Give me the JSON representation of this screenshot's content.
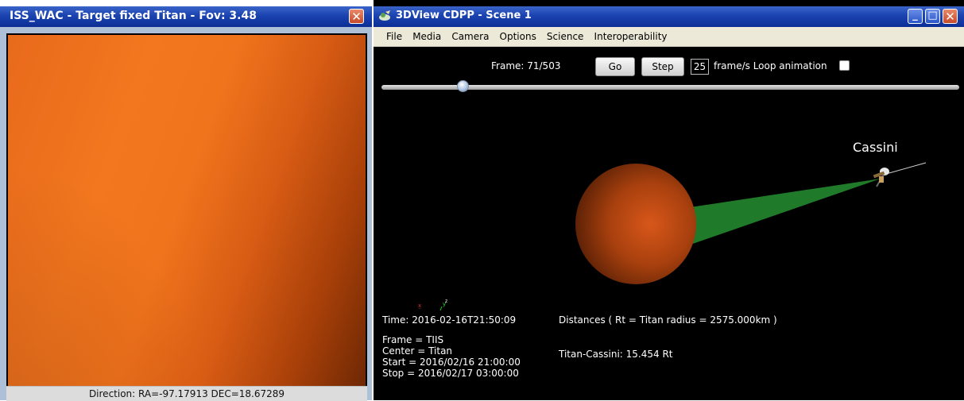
{
  "left_window": {
    "title": "ISS_WAC - Target fixed Titan -  Fov: 3.48",
    "close_label": "✕",
    "status": "Direction: RA=-97.17913 DEC=18.67289"
  },
  "right_window": {
    "title": "3DView CDPP - Scene 1",
    "buttons": {
      "minimize": "_",
      "maximize": "□",
      "close": "✕"
    },
    "menu": [
      "File",
      "Media",
      "Camera",
      "Options",
      "Science",
      "Interoperability"
    ]
  },
  "animation": {
    "frame_label": "Frame: 71/503",
    "go_label": "Go",
    "step_label": "Step",
    "fps_value": "25",
    "fps_label": "frame/s  Loop animation",
    "loop_checked": false,
    "progress_fraction": 0.141
  },
  "scene": {
    "spacecraft_label": "Cassini",
    "axes": {
      "x": "x",
      "y": "y",
      "z": "z"
    },
    "time": "Time: 2016-02-16T21:50:09",
    "distances_title": "Distances ( Rt = Titan radius = 2575.000km )",
    "frame_line": "Frame = TIIS",
    "center_line": "Center = Titan",
    "start_line": "Start = 2016/02/16 21:00:00",
    "stop_line": "Stop = 2016/02/17 03:00:00",
    "distance_value": "Titan-Cassini: 15.454 Rt"
  },
  "colors": {
    "titlebar": "#1b43b0",
    "titan": "#b84a10",
    "fov_cone": "#1f7a2a",
    "camera_image": "#f2771e"
  }
}
